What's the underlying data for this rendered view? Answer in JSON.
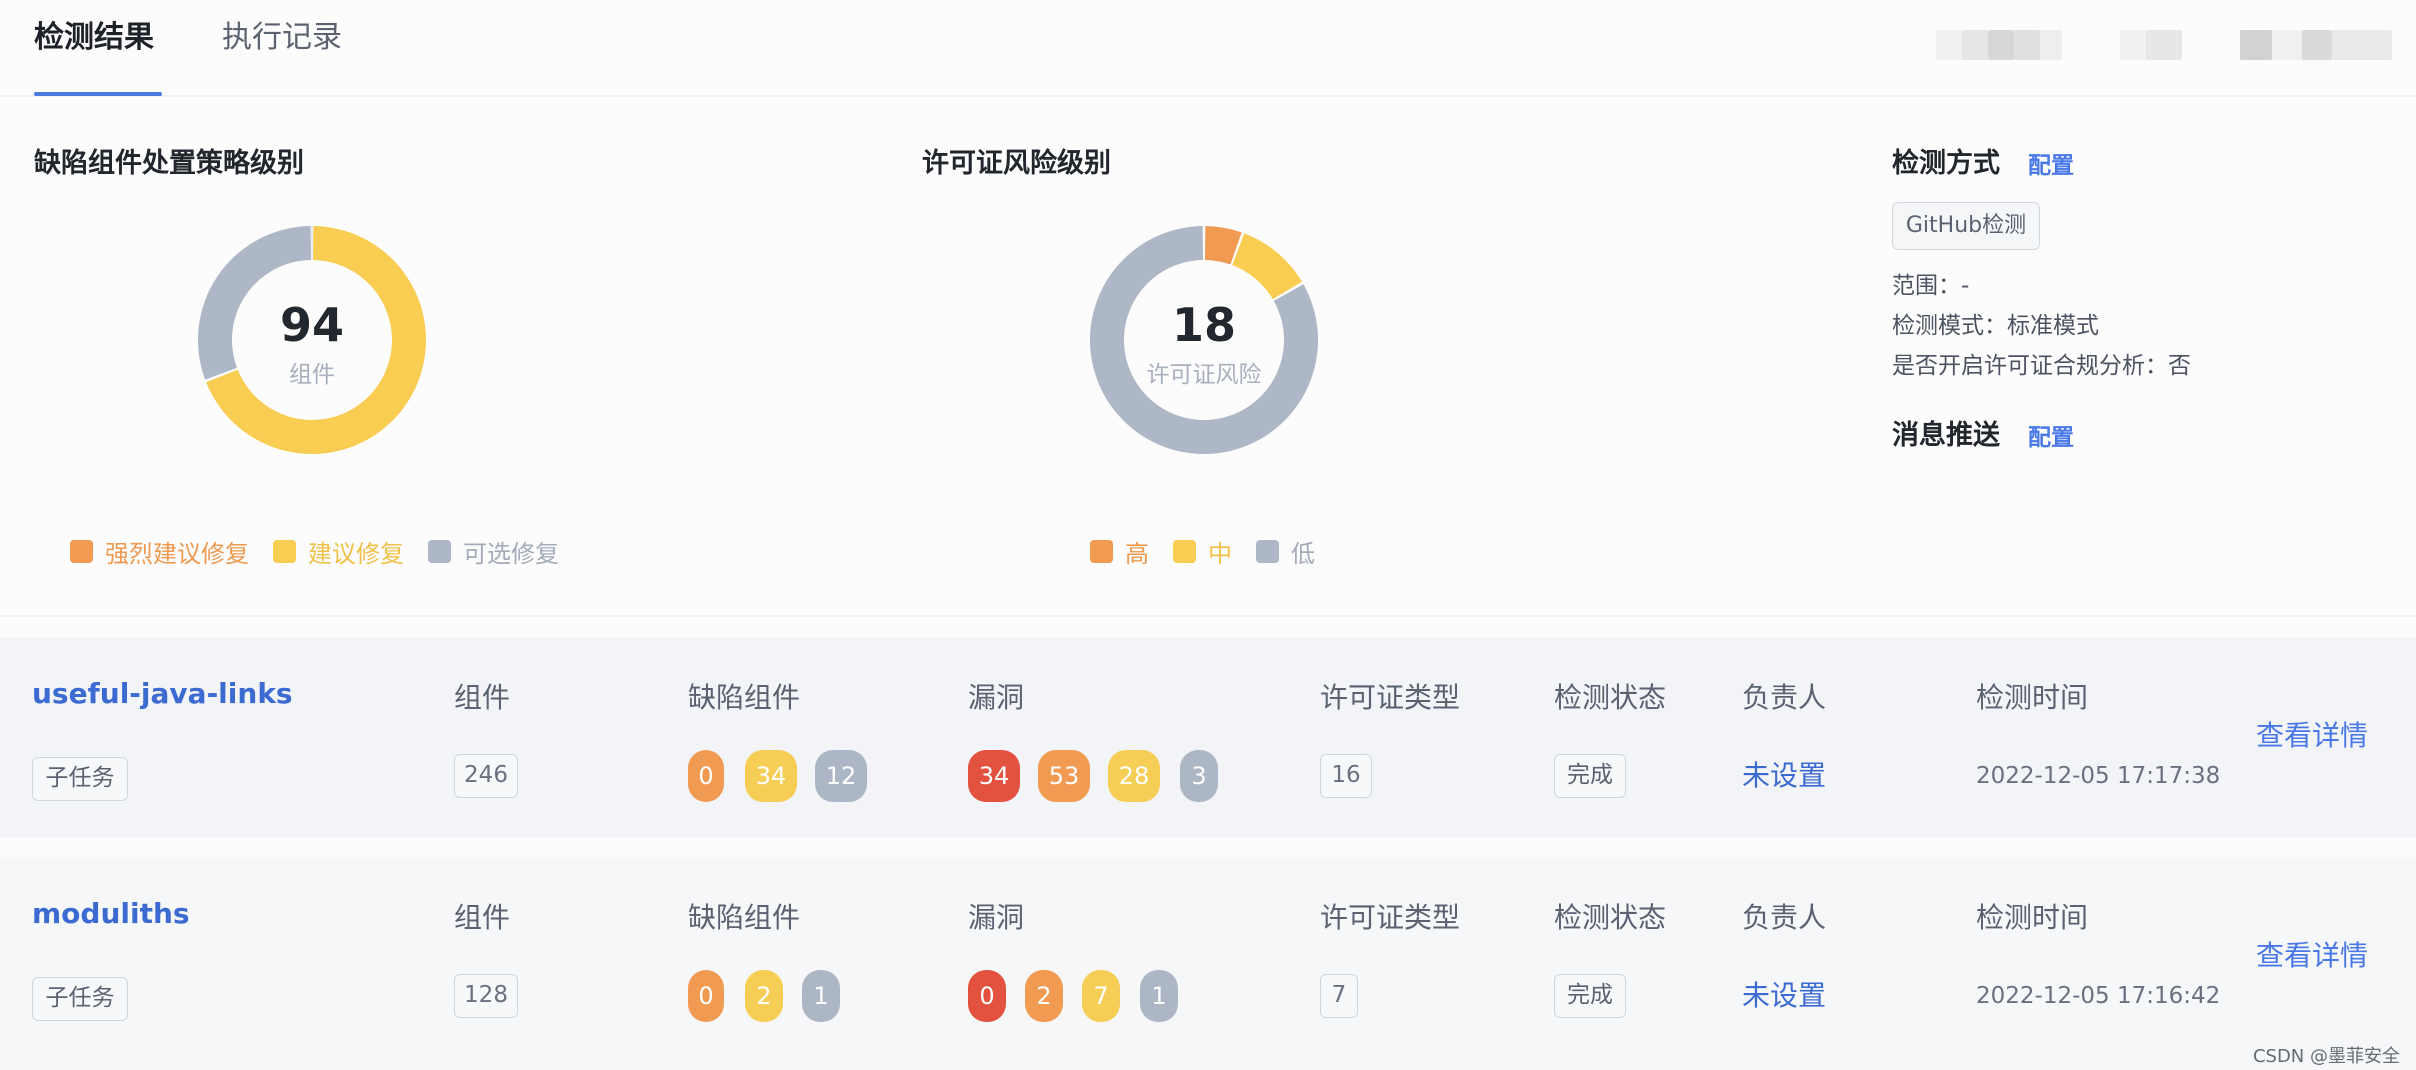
{
  "tabs": [
    {
      "label": "检测结果",
      "active": true
    },
    {
      "label": "执行记录",
      "active": false
    }
  ],
  "defect_chart": {
    "title": "缺陷组件处置策略级别",
    "total": "94",
    "center_label": "组件",
    "legend": [
      "强烈建议修复",
      "建议修复",
      "可选修复"
    ]
  },
  "license_chart": {
    "title": "许可证风险级别",
    "total": "18",
    "center_label": "许可证风险",
    "legend": [
      "高",
      "中",
      "低"
    ]
  },
  "chart_data": [
    {
      "type": "pie",
      "title": "缺陷组件处置策略级别",
      "categories": [
        "强烈建议修复",
        "建议修复",
        "可选修复"
      ],
      "values": [
        0,
        65,
        29
      ],
      "colors": [
        "#f09a52",
        "#f8cd52",
        "#adb7c6"
      ],
      "center_value": 94
    },
    {
      "type": "pie",
      "title": "许可证风险级别",
      "categories": [
        "高",
        "中",
        "低"
      ],
      "values": [
        1,
        2,
        15
      ],
      "colors": [
        "#f09a52",
        "#f8cd52",
        "#adb7c6"
      ],
      "center_value": 18
    }
  ],
  "detection": {
    "title": "检测方式",
    "config_label": "配置",
    "method_tag": "GitHub检测",
    "scope": "范围：-",
    "mode": "检测模式：标准模式",
    "license_analysis": "是否开启许可证合规分析：否"
  },
  "push": {
    "title": "消息推送",
    "config_label": "配置"
  },
  "columns": {
    "components": "组件",
    "defect_components": "缺陷组件",
    "vulnerabilities": "漏洞",
    "license_types": "许可证类型",
    "status": "检测状态",
    "owner": "负责人",
    "time": "检测时间"
  },
  "projects": [
    {
      "name": "useful-java-links",
      "tag": "子任务",
      "components": "246",
      "defects": [
        "0",
        "34",
        "12"
      ],
      "vulns": [
        "34",
        "53",
        "28",
        "3"
      ],
      "license_types": "16",
      "status": "完成",
      "owner": "未设置",
      "time": "2022-12-05 17:17:38",
      "detail_label": "查看详情"
    },
    {
      "name": "moduliths",
      "tag": "子任务",
      "components": "128",
      "defects": [
        "0",
        "2",
        "1"
      ],
      "vulns": [
        "0",
        "2",
        "7",
        "1"
      ],
      "license_types": "7",
      "status": "完成",
      "owner": "未设置",
      "time": "2022-12-05 17:16:42",
      "detail_label": "查看详情"
    }
  ],
  "colors": {
    "accent": "#4a7ae0",
    "high": "#f09a52",
    "medium": "#f8cd52",
    "low": "#adb7c6",
    "critical": "#e3523f"
  },
  "watermark": "CSDN @墨菲安全"
}
